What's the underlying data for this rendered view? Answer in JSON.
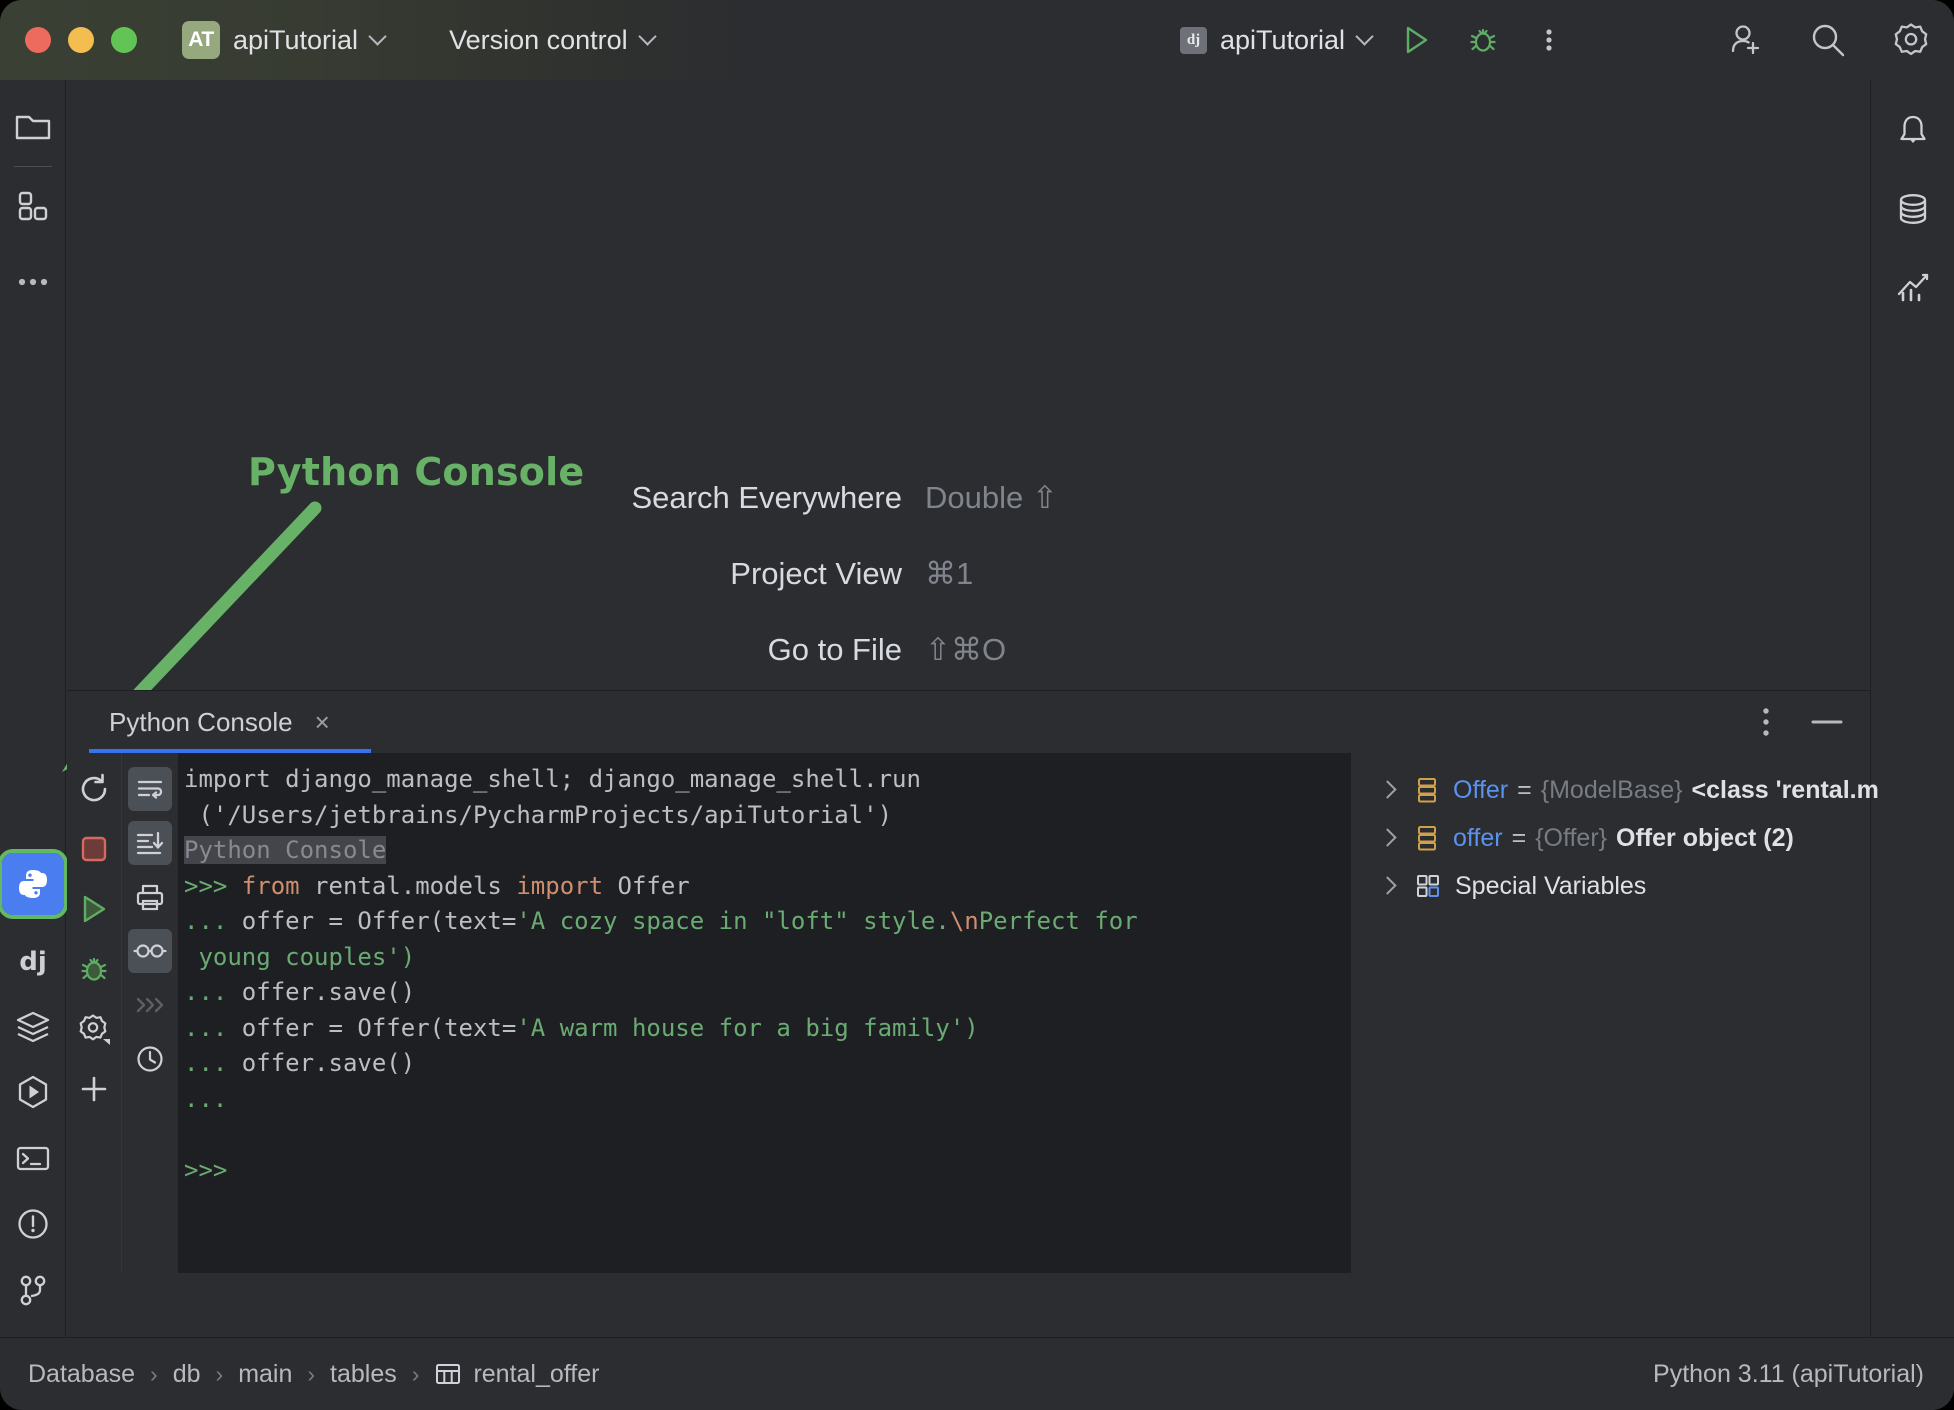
{
  "window": {
    "traffic_lights": [
      "close",
      "minimize",
      "zoom"
    ],
    "project_badge": "AT",
    "project_name": "apiTutorial",
    "vcs_label": "Version control",
    "run_config_badge": "dj",
    "run_config_name": "apiTutorial",
    "titlebar_icons": [
      "run-icon",
      "debug-icon",
      "more-options-icon",
      "add-user-icon",
      "search-icon",
      "settings-icon"
    ]
  },
  "left_toolbar": {
    "top_items": [
      {
        "name": "project-icon",
        "label": "Project"
      },
      {
        "name": "structure-icon",
        "label": "Structure"
      },
      {
        "name": "more-tool-windows-icon",
        "label": "More tool windows"
      }
    ],
    "bottom_items": [
      {
        "name": "python-console-icon",
        "label": "Python Console",
        "active": true
      },
      {
        "name": "django-icon",
        "label": "Django"
      },
      {
        "name": "database-layers-icon",
        "label": "Services"
      },
      {
        "name": "run-hexagon-icon",
        "label": "Run"
      },
      {
        "name": "terminal-icon",
        "label": "Terminal"
      },
      {
        "name": "problems-icon",
        "label": "Problems"
      },
      {
        "name": "version-control-branch-icon",
        "label": "Version Control"
      }
    ]
  },
  "right_toolbar": {
    "items": [
      {
        "name": "notifications-bell-icon",
        "label": "Notifications"
      },
      {
        "name": "database-icon",
        "label": "Database"
      },
      {
        "name": "profiler-chart-icon",
        "label": "Profiler"
      }
    ]
  },
  "editor_hints": [
    {
      "label": "Search Everywhere",
      "shortcut": "Double ⇧"
    },
    {
      "label": "Project View",
      "shortcut": "⌘1"
    },
    {
      "label": "Go to File",
      "shortcut": "⇧⌘O"
    }
  ],
  "annotation": {
    "text": "Python Console",
    "color": "#68b268"
  },
  "tool_window": {
    "tab_label": "Python Console",
    "close_label": "×",
    "header_icons": [
      "options-kebab-icon",
      "hide-minimize-icon"
    ],
    "toolbar_left": [
      {
        "name": "rerun-icon",
        "label": "Rerun Console"
      },
      {
        "name": "stop-icon",
        "label": "Stop"
      },
      {
        "name": "execute-icon",
        "label": "Execute"
      },
      {
        "name": "debug-console-icon",
        "label": "Attach Debugger"
      },
      {
        "name": "settings-gear-icon",
        "label": "Settings"
      },
      {
        "name": "new-console-icon",
        "label": "New Console"
      }
    ],
    "toolbar_right": [
      {
        "name": "soft-wrap-icon",
        "label": "Soft-Wrap",
        "selected": true
      },
      {
        "name": "scroll-to-end-icon",
        "label": "Scroll to the end",
        "selected": true
      },
      {
        "name": "print-icon",
        "label": "Print",
        "selected": false
      },
      {
        "name": "show-variables-icon",
        "label": "Show Variables",
        "selected": true
      },
      {
        "name": "fast-forward-icon",
        "label": "Execute Multiline",
        "selected": false
      },
      {
        "name": "history-clock-icon",
        "label": "History",
        "selected": false
      }
    ]
  },
  "console": {
    "lines": [
      {
        "segments": [
          {
            "text": "import django_manage_shell; django_manage_shell.run",
            "style": "plain"
          }
        ]
      },
      {
        "segments": [
          {
            "text": " ('/Users/jetbrains/PycharmProjects/apiTutorial')",
            "style": "plain"
          }
        ]
      },
      {
        "segments": [
          {
            "text": "Python Console",
            "style": "highlight"
          }
        ]
      },
      {
        "segments": [
          {
            "text": ">>> ",
            "style": "prompt"
          },
          {
            "text": "from",
            "style": "keyword"
          },
          {
            "text": " rental.models ",
            "style": "plain"
          },
          {
            "text": "import",
            "style": "keyword"
          },
          {
            "text": " Offer",
            "style": "plain"
          }
        ]
      },
      {
        "segments": [
          {
            "text": "... ",
            "style": "prompt"
          },
          {
            "text": "offer = Offer(text=",
            "style": "plain"
          },
          {
            "text": "'A cozy space in \"loft\" style.",
            "style": "string"
          },
          {
            "text": "\\n",
            "style": "escape"
          },
          {
            "text": "Perfect for",
            "style": "string"
          }
        ]
      },
      {
        "segments": [
          {
            "text": " young couples')",
            "style": "string"
          }
        ]
      },
      {
        "segments": [
          {
            "text": "... ",
            "style": "prompt"
          },
          {
            "text": "offer.save()",
            "style": "plain"
          }
        ]
      },
      {
        "segments": [
          {
            "text": "... ",
            "style": "prompt"
          },
          {
            "text": "offer = Offer(text=",
            "style": "plain"
          },
          {
            "text": "'A warm house for a big family')",
            "style": "string"
          }
        ]
      },
      {
        "segments": [
          {
            "text": "... ",
            "style": "prompt"
          },
          {
            "text": "offer.save()",
            "style": "plain"
          }
        ]
      },
      {
        "segments": [
          {
            "text": "... ",
            "style": "prompt"
          }
        ]
      },
      {
        "segments": [
          {
            "text": "",
            "style": "plain"
          }
        ]
      },
      {
        "segments": [
          {
            "text": ">>> ",
            "style": "prompt"
          }
        ]
      }
    ]
  },
  "variables": {
    "rows": [
      {
        "icon": "object-variable-icon",
        "name": "Offer",
        "eq": "=",
        "type": "{ModelBase}",
        "value": "<class 'rental.m",
        "expandable": true
      },
      {
        "icon": "object-variable-icon",
        "name": "offer",
        "eq": "=",
        "type": "{Offer}",
        "value": "Offer object (2)",
        "expandable": true
      },
      {
        "icon": "special-variables-icon",
        "name": "",
        "eq": "",
        "type": "",
        "value": "Special Variables",
        "expandable": true
      }
    ]
  },
  "status_bar": {
    "breadcrumb": [
      "Database",
      "db",
      "main",
      "tables",
      "rental_offer"
    ],
    "breadcrumb_separator": "›",
    "table_icon": "table-icon",
    "interpreter": "Python 3.11 (apiTutorial)"
  },
  "colors": {
    "accent_blue": "#3574f0",
    "annotation_green": "#68b268",
    "console_bg": "#1e1f22",
    "panel_bg": "#2b2d30",
    "string_green": "#6aab73",
    "keyword_orange": "#cf8e6d",
    "variable_blue": "#5a92f0"
  }
}
